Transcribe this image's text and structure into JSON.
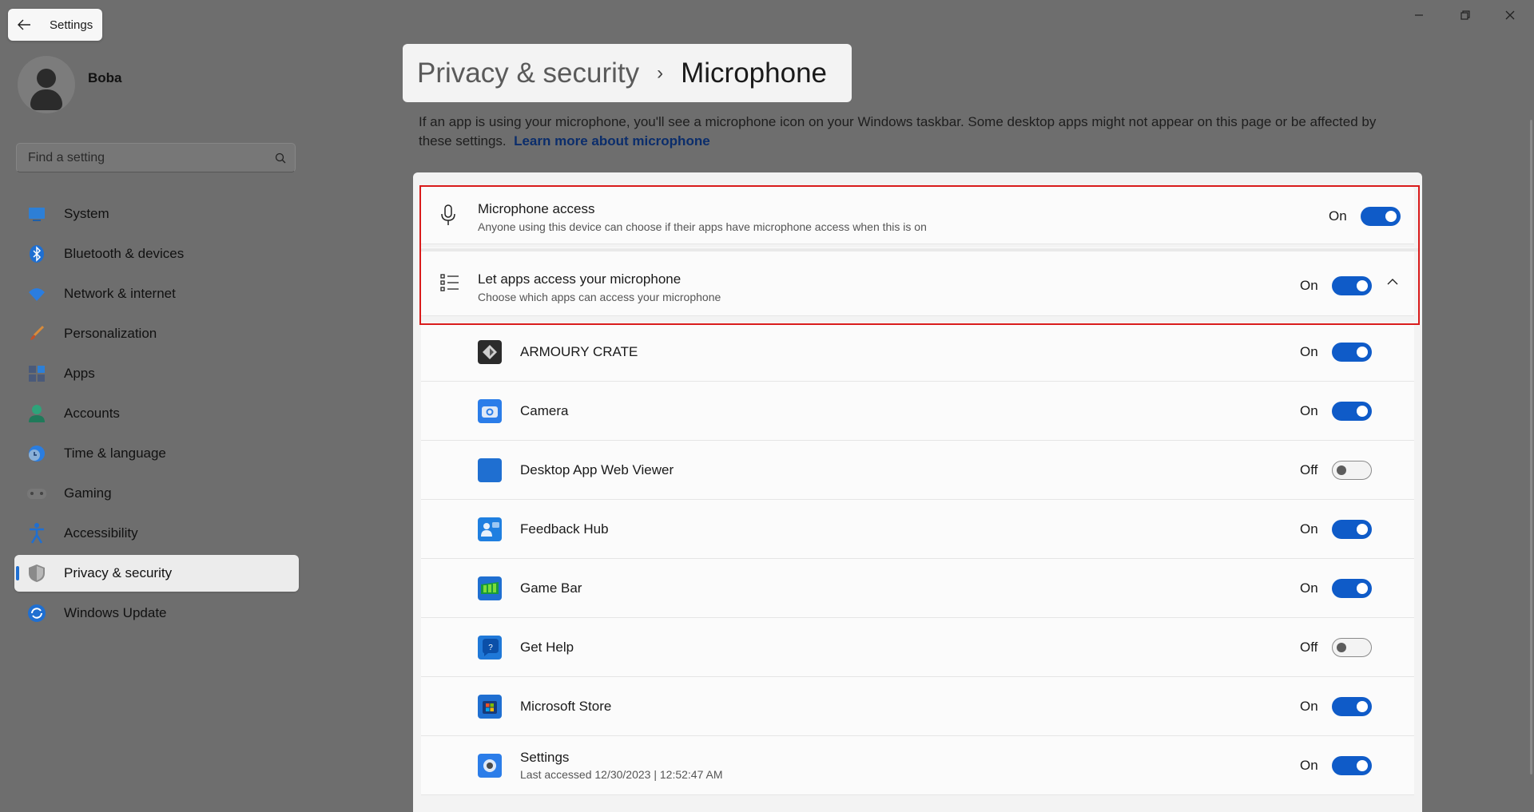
{
  "window": {
    "title": "Settings",
    "controls": [
      "minimize-icon",
      "restore-icon",
      "close-icon"
    ]
  },
  "profile": {
    "name": "Boba"
  },
  "search": {
    "placeholder": "Find a setting"
  },
  "nav": {
    "items": [
      {
        "label": "System",
        "icon": "system-icon",
        "color": "#2d7fd6"
      },
      {
        "label": "Bluetooth & devices",
        "icon": "bluetooth-icon",
        "color": "#1f6fd1"
      },
      {
        "label": "Network & internet",
        "icon": "wifi-icon",
        "color": "#2a7de0"
      },
      {
        "label": "Personalization",
        "icon": "brush-icon",
        "color": "#d98b3a"
      },
      {
        "label": "Apps",
        "icon": "apps-icon",
        "color": "#4a5a7a"
      },
      {
        "label": "Accounts",
        "icon": "accounts-icon",
        "color": "#2ea37a"
      },
      {
        "label": "Time & language",
        "icon": "clock-globe-icon",
        "color": "#2a7de0"
      },
      {
        "label": "Gaming",
        "icon": "gamepad-icon",
        "color": "#777777"
      },
      {
        "label": "Accessibility",
        "icon": "accessibility-icon",
        "color": "#1f6fd1"
      },
      {
        "label": "Privacy & security",
        "icon": "shield-icon",
        "color": "#8a8a8a",
        "active": true
      },
      {
        "label": "Windows Update",
        "icon": "update-icon",
        "color": "#1f6fd1"
      }
    ]
  },
  "page": {
    "breadcrumb_parent": "Privacy & security",
    "breadcrumb_sep": "›",
    "title": "Microphone",
    "description": "If an app is using your microphone, you'll see a microphone icon on your Windows taskbar. Some desktop apps might not appear on this page or be affected by these settings.",
    "learn_more": "Learn more about microphone"
  },
  "settings": {
    "mic_access": {
      "title": "Microphone access",
      "subtitle": "Anyone using this device can choose if their apps have microphone access when this is on",
      "state": "On"
    },
    "let_apps": {
      "title": "Let apps access your microphone",
      "subtitle": "Choose which apps can access your microphone",
      "state": "On"
    }
  },
  "apps": [
    {
      "name": "ARMOURY CRATE",
      "state": "On",
      "icon": "armoury-crate-icon",
      "color": "#2b2b2b"
    },
    {
      "name": "Camera",
      "state": "On",
      "icon": "camera-icon",
      "color": "#2b7de9"
    },
    {
      "name": "Desktop App Web Viewer",
      "state": "Off",
      "icon": "web-viewer-icon",
      "color": "#1f6fd1"
    },
    {
      "name": "Feedback Hub",
      "state": "On",
      "icon": "feedback-hub-icon",
      "color": "#1f7fe0"
    },
    {
      "name": "Game Bar",
      "state": "On",
      "icon": "game-bar-icon",
      "color": "#1f6fd1"
    },
    {
      "name": "Get Help",
      "state": "Off",
      "icon": "get-help-icon",
      "color": "#1f78d8"
    },
    {
      "name": "Microsoft Store",
      "state": "On",
      "icon": "store-icon",
      "color": "#1f6fd1"
    },
    {
      "name": "Settings",
      "state": "On",
      "icon": "settings-gear-icon",
      "color": "#2b7de9",
      "last_accessed": "Last accessed 12/30/2023  |  12:52:47 AM"
    }
  ]
}
